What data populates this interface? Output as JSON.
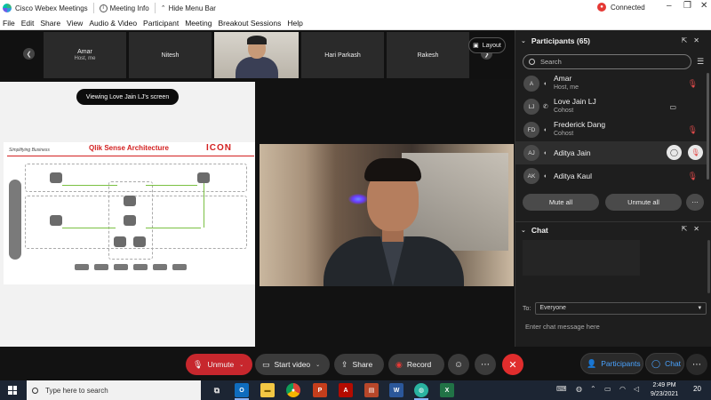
{
  "titlebar": {
    "app_title": "Cisco Webex Meetings",
    "meeting_info": "Meeting Info",
    "hide_menu_bar": "Hide Menu Bar",
    "connection_status": "Connected"
  },
  "menu": {
    "items": [
      "File",
      "Edit",
      "Share",
      "View",
      "Audio & Video",
      "Participant",
      "Meeting",
      "Breakout Sessions",
      "Help"
    ]
  },
  "video_strip": {
    "tiles": [
      {
        "name": "Amar",
        "role": "Host, me"
      },
      {
        "name": "Nitesh",
        "role": ""
      },
      {
        "name": "",
        "role": ""
      },
      {
        "name": "Hari Parkash",
        "role": ""
      },
      {
        "name": "Rakesh",
        "role": ""
      }
    ],
    "layout_label": "Layout"
  },
  "share": {
    "viewing_label": "Viewing Love Jain LJ's screen",
    "slide_tagline": "Simplifying Business",
    "slide_title": "Qlik Sense Architecture",
    "slide_logo": "ICON"
  },
  "participants": {
    "header": "Participants (65)",
    "search_placeholder": "Search",
    "list": [
      {
        "initials": "A",
        "name": "Amar",
        "role": "Host, me",
        "mic_muted": true
      },
      {
        "initials": "LJ",
        "name": "Love Jain LJ",
        "role": "Cohost",
        "mic_muted": false
      },
      {
        "initials": "FD",
        "name": "Frederick Dang",
        "role": "Cohost",
        "mic_muted": true
      },
      {
        "initials": "AJ",
        "name": "Aditya Jain",
        "role": "",
        "mic_muted": true
      },
      {
        "initials": "AK",
        "name": "Aditya Kaul",
        "role": "",
        "mic_muted": true
      }
    ],
    "mute_all": "Mute all",
    "unmute_all": "Unmute all"
  },
  "chat": {
    "header": "Chat",
    "to_label": "To:",
    "to_value": "Everyone",
    "input_placeholder": "Enter chat message here"
  },
  "toolbar": {
    "unmute": "Unmute",
    "start_video": "Start video",
    "share": "Share",
    "record": "Record",
    "participants": "Participants",
    "chat": "Chat"
  },
  "taskbar": {
    "search_placeholder": "Type here to search",
    "time": "2:49 PM",
    "date": "9/23/2021",
    "notification_count": "20"
  },
  "colors": {
    "accent_blue": "#4aa3ff",
    "end_red": "#e02d2d",
    "mute_red": "#c7272d",
    "slide_red": "#d32020"
  }
}
